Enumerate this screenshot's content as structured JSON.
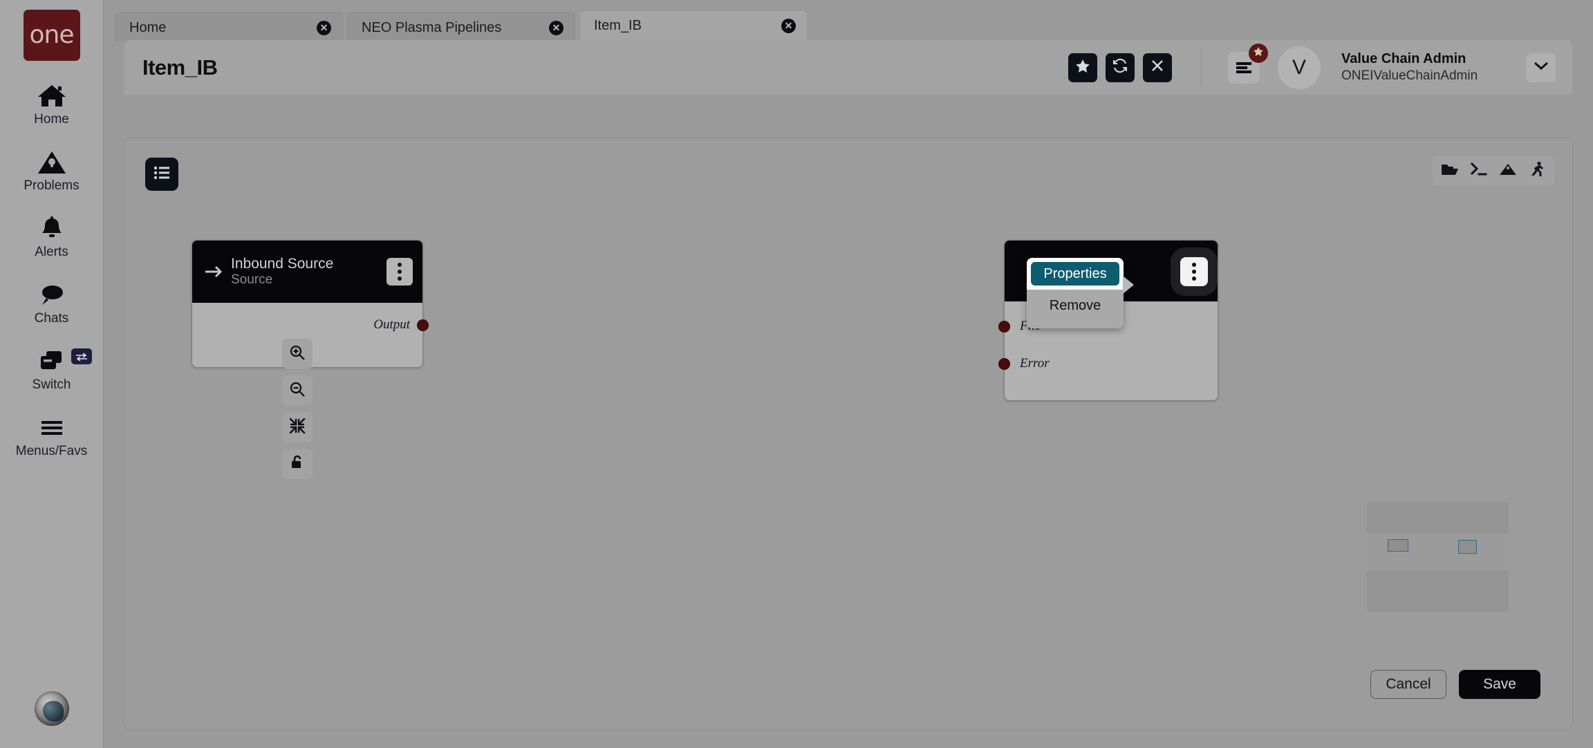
{
  "sidebar": {
    "logo_text": "one",
    "items": [
      {
        "label": "Home",
        "icon": "home-icon"
      },
      {
        "label": "Problems",
        "icon": "warning-triangle-icon"
      },
      {
        "label": "Alerts",
        "icon": "bell-icon"
      },
      {
        "label": "Chats",
        "icon": "chat-bubble-icon"
      },
      {
        "label": "Switch",
        "icon": "switch-windows-icon",
        "badge_icon": "swap-arrows-icon"
      },
      {
        "label": "Menus/Favs",
        "icon": "hamburger-icon"
      }
    ]
  },
  "tabs": [
    {
      "label": "Home",
      "active": false
    },
    {
      "label": "NEO Plasma Pipelines",
      "active": false
    },
    {
      "label": "Item_IB",
      "active": true
    }
  ],
  "header": {
    "title": "Item_IB",
    "actions": [
      {
        "name": "favorite-button",
        "icon": "star-icon"
      },
      {
        "name": "refresh-button",
        "icon": "refresh-icon"
      },
      {
        "name": "close-button",
        "icon": "close-x-icon"
      }
    ],
    "menu_icon": "list-menu-icon",
    "menu_badge_icon": "star-icon",
    "user": {
      "initial": "V",
      "name": "Value Chain Admin",
      "username": "ONEIValueChainAdmin"
    },
    "caret_icon": "chevron-down-icon"
  },
  "canvas": {
    "list_button_icon": "list-icon",
    "tools": [
      {
        "name": "open-folder-tool",
        "icon": "folder-open-icon"
      },
      {
        "name": "console-tool",
        "icon": "terminal-icon"
      },
      {
        "name": "image-tool",
        "icon": "mountain-image-icon"
      },
      {
        "name": "run-tool",
        "icon": "running-person-icon"
      }
    ],
    "zoom_tools": [
      {
        "name": "zoom-in-button",
        "icon": "zoom-in-icon"
      },
      {
        "name": "zoom-out-button",
        "icon": "zoom-out-icon"
      },
      {
        "name": "fit-to-screen-button",
        "icon": "collapse-arrows-icon"
      },
      {
        "name": "lock-toggle-button",
        "icon": "unlock-icon"
      }
    ],
    "nodes": [
      {
        "id": "inbound-source",
        "title": "Inbound Source",
        "subtitle": "Source",
        "head_icon": "arrow-right-icon",
        "kebab_icon": "kebab-menu-icon",
        "outputs": [
          {
            "label": "Output"
          }
        ],
        "inputs": []
      },
      {
        "id": "target-node",
        "title": "",
        "subtitle": "",
        "kebab_icon": "kebab-menu-icon",
        "outputs": [],
        "inputs": [
          {
            "label": "File"
          },
          {
            "label": "Error"
          }
        ]
      }
    ],
    "context_menu": {
      "items": [
        {
          "label": "Properties",
          "selected": true
        },
        {
          "label": "Remove",
          "selected": false
        }
      ]
    }
  },
  "footer": {
    "cancel_label": "Cancel",
    "save_label": "Save"
  },
  "colors": {
    "brand_maroon": "#5a1618",
    "accent_teal": "#0c5d70",
    "node_header": "#07070a",
    "port_dot": "#4a0d0d",
    "minimap_outline": "#2f6b8c"
  }
}
